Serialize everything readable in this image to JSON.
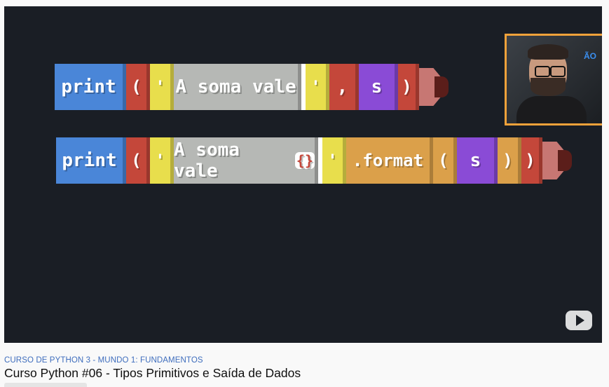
{
  "video": {
    "row1": {
      "print": "print",
      "open_paren": "(",
      "quote_open": "'",
      "string_text": "A soma vale",
      "quote_close": "'",
      "comma": ",",
      "var": "s",
      "close_paren": ")"
    },
    "row2": {
      "print": "print",
      "open_paren": "(",
      "quote_open": "'",
      "string_text": "A soma vale",
      "braces": "{}",
      "quote_close": "'",
      "format": ".format",
      "fmt_open": "(",
      "var": "s",
      "fmt_close": ")",
      "close_paren": ")"
    },
    "webcam_sticker": "ÃO",
    "logo_icon": "youtube-play-icon"
  },
  "meta": {
    "course_label": "CURSO DE PYTHON 3 - MUNDO 1: FUNDAMENTOS",
    "video_title": "Curso Python #06 - Tipos Primitivos e Saída de Dados"
  },
  "colors": {
    "print_block": "#4a86d8",
    "paren_block": "#c4473a",
    "quote_block": "#e8de4c",
    "string_block": "#b6b8b5",
    "var_block": "#8a4bd6",
    "format_block": "#dba04a",
    "webcam_border": "#f2a23a"
  }
}
